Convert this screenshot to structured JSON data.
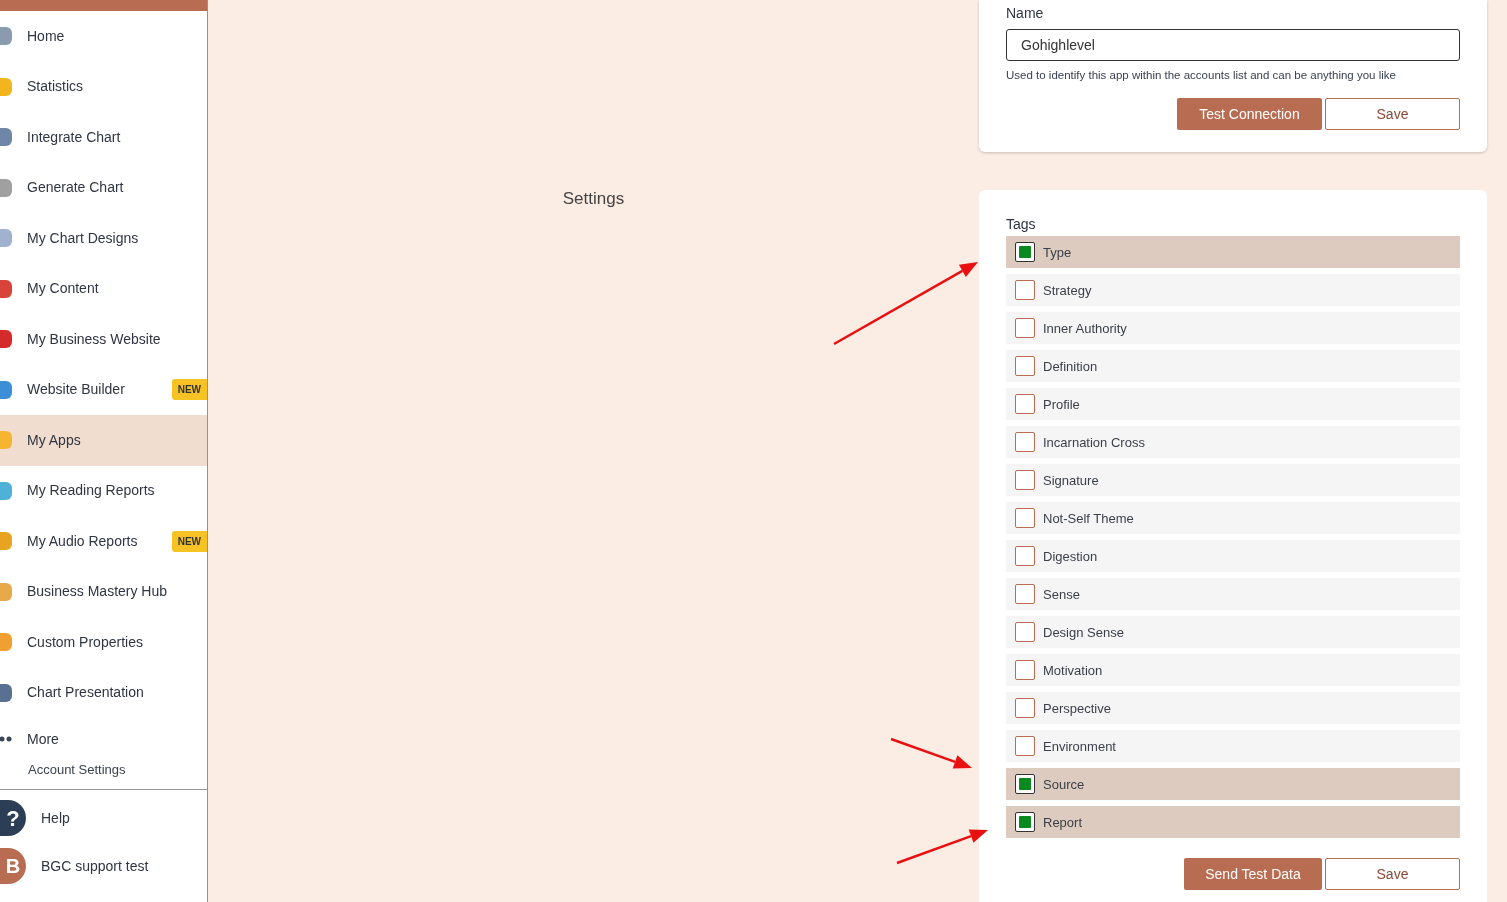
{
  "sidebar": {
    "items": [
      {
        "label": "Home",
        "selected": false,
        "color": "#8a9bb0"
      },
      {
        "label": "Statistics",
        "selected": false,
        "color": "#f2b51e"
      },
      {
        "label": "Integrate Chart",
        "selected": false,
        "color": "#6f86a6"
      },
      {
        "label": "Generate Chart",
        "selected": false,
        "color": "#a0a0a0"
      },
      {
        "label": "My Chart Designs",
        "selected": false,
        "color": "#9fb3d1"
      },
      {
        "label": "My Content",
        "selected": false,
        "color": "#d9443a"
      },
      {
        "label": "My Business Website",
        "selected": false,
        "color": "#d42a2a"
      },
      {
        "label": "Website Builder",
        "selected": false,
        "color": "#3c8fd6",
        "badge": "NEW"
      },
      {
        "label": "My Apps",
        "selected": true,
        "color": "#f5b530"
      },
      {
        "label": "My Reading Reports",
        "selected": false,
        "color": "#4fb0d8"
      },
      {
        "label": "My Audio Reports",
        "selected": false,
        "color": "#e8a420",
        "badge": "NEW"
      },
      {
        "label": "Business Mastery Hub",
        "selected": false,
        "color": "#e8a94a"
      },
      {
        "label": "Custom Properties",
        "selected": false,
        "color": "#f0a030"
      },
      {
        "label": "Chart Presentation",
        "selected": false,
        "color": "#5a7090"
      }
    ],
    "more": "More",
    "account_settings": "Account Settings",
    "help_icon": "?",
    "help": "Help",
    "user": {
      "initial": "B",
      "name": "BGC support test"
    }
  },
  "page_title": "Settings",
  "name_card": {
    "label": "Name",
    "value": "Gohighlevel",
    "hint": "Used to identify this app within the accounts list and can be anything you like",
    "buttons": [
      "Test Connection",
      "Save"
    ]
  },
  "tags_card": {
    "label": "Tags",
    "tags": [
      {
        "label": "Type",
        "checked": true
      },
      {
        "label": "Strategy",
        "checked": false
      },
      {
        "label": "Inner Authority",
        "checked": false
      },
      {
        "label": "Definition",
        "checked": false
      },
      {
        "label": "Profile",
        "checked": false
      },
      {
        "label": "Incarnation Cross",
        "checked": false
      },
      {
        "label": "Signature",
        "checked": false
      },
      {
        "label": "Not-Self Theme",
        "checked": false
      },
      {
        "label": "Digestion",
        "checked": false
      },
      {
        "label": "Sense",
        "checked": false
      },
      {
        "label": "Design Sense",
        "checked": false
      },
      {
        "label": "Motivation",
        "checked": false
      },
      {
        "label": "Perspective",
        "checked": false
      },
      {
        "label": "Environment",
        "checked": false
      },
      {
        "label": "Source",
        "checked": true
      },
      {
        "label": "Report",
        "checked": true
      }
    ],
    "buttons": [
      "Send Test Data",
      "Save"
    ]
  }
}
